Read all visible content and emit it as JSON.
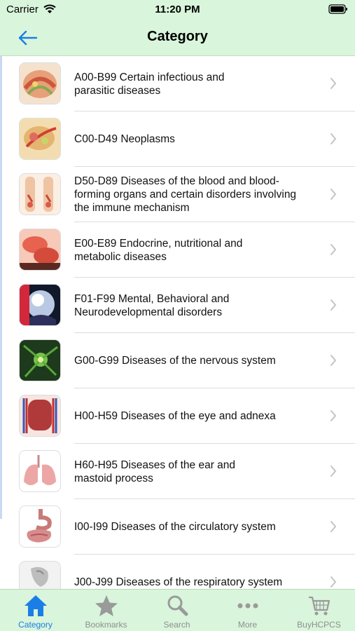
{
  "status": {
    "carrier": "Carrier",
    "time": "11:20 PM"
  },
  "nav": {
    "title": "Category"
  },
  "rows": [
    {
      "label": "A00-B99  Certain infectious and\nparasitic diseases",
      "icon": "infection-icon"
    },
    {
      "label": "C00-D49  Neoplasms",
      "icon": "neoplasm-icon"
    },
    {
      "label": "D50-D89  Diseases of the blood and blood-\nforming organs and certain disorders involving\nthe immune mechanism",
      "icon": "blood-icon"
    },
    {
      "label": "E00-E89  Endocrine, nutritional and\nmetabolic diseases",
      "icon": "endocrine-icon"
    },
    {
      "label": "F01-F99  Mental, Behavioral and\nNeurodevelopmental disorders",
      "icon": "brain-icon"
    },
    {
      "label": "G00-G99  Diseases of the nervous system",
      "icon": "neuron-icon"
    },
    {
      "label": "H00-H59  Diseases of the eye and adnexa",
      "icon": "eye-icon"
    },
    {
      "label": "H60-H95  Diseases of the ear and\nmastoid process",
      "icon": "lungs-icon"
    },
    {
      "label": "I00-I99  Diseases of the circulatory system",
      "icon": "digestive-icon"
    },
    {
      "label": "J00-J99  Diseases of the respiratory system",
      "icon": "respiratory-icon"
    }
  ],
  "tabs": [
    {
      "label": "Category",
      "icon": "home-icon",
      "active": true
    },
    {
      "label": "Bookmarks",
      "icon": "star-icon",
      "active": false
    },
    {
      "label": "Search",
      "icon": "search-icon",
      "active": false
    },
    {
      "label": "More",
      "icon": "more-icon",
      "active": false
    },
    {
      "label": "BuyHCPCS",
      "icon": "cart-icon",
      "active": false
    }
  ],
  "colors": {
    "bar_bg": "#d9f5dc",
    "accent": "#1a7ee6",
    "inactive": "#8f8f8f"
  }
}
